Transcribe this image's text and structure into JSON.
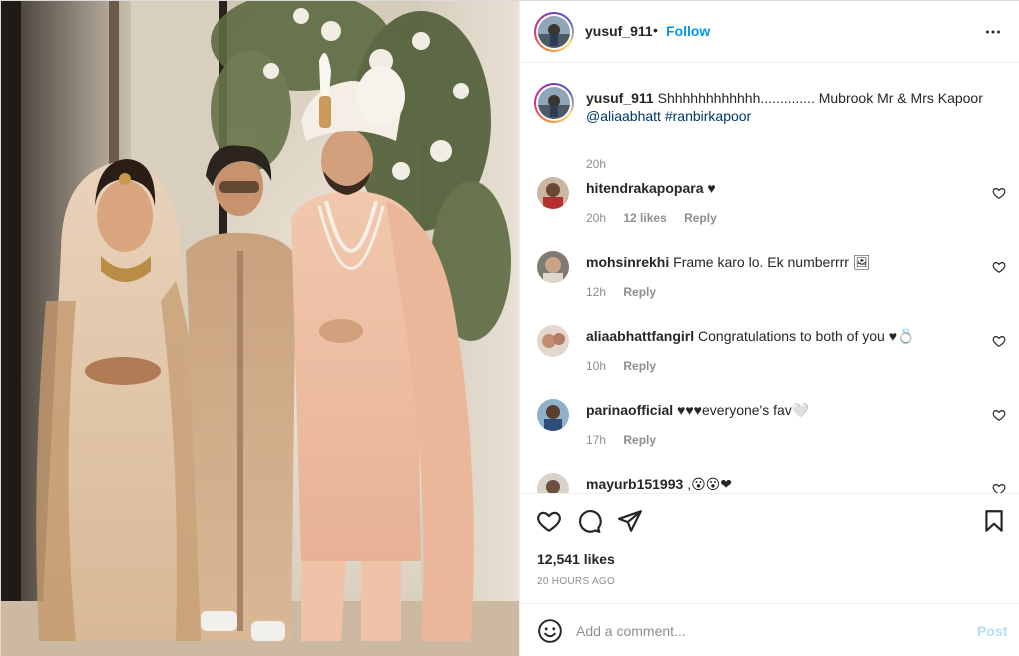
{
  "post": {
    "username": "yusuf_911",
    "separator": "•",
    "follow_label": "Follow",
    "more_icon": "more-horizontal-icon"
  },
  "caption": {
    "username": "yusuf_911",
    "text": "Shhhhhhhhhhhh.............. Mubrook Mr & Mrs Kapoor",
    "mention": "@aliaabhatt",
    "hashtag": "#ranbirkapoor",
    "time": "20h"
  },
  "comments": [
    {
      "username": "hitendrakapopara",
      "text": "♥",
      "time": "20h",
      "likes": "12 likes",
      "reply": "Reply"
    },
    {
      "username": "mohsinrekhi",
      "text": "Frame karo lo. Ek numberrrr 🖼",
      "time": "12h",
      "likes": "",
      "reply": "Reply"
    },
    {
      "username": "aliaabhattfangirl",
      "text": "Congratulations to both of you ♥💍",
      "time": "10h",
      "likes": "",
      "reply": "Reply"
    },
    {
      "username": "parinaofficial",
      "text": "♥♥♥everyone's fav🤍",
      "time": "17h",
      "likes": "",
      "reply": "Reply"
    },
    {
      "username": "mayurb151993",
      "text": ",😮😮❤",
      "time": "",
      "likes": "",
      "reply": ""
    }
  ],
  "stats": {
    "likes": "12,541 likes",
    "time_ago": "20 HOURS AGO"
  },
  "add_comment": {
    "placeholder": "Add a comment...",
    "post_label": "Post"
  },
  "colors": {
    "link_blue": "#0095f6",
    "mention_blue": "#00376b",
    "post_disabled": "#b2dffc",
    "muted": "#8e8e8e"
  }
}
